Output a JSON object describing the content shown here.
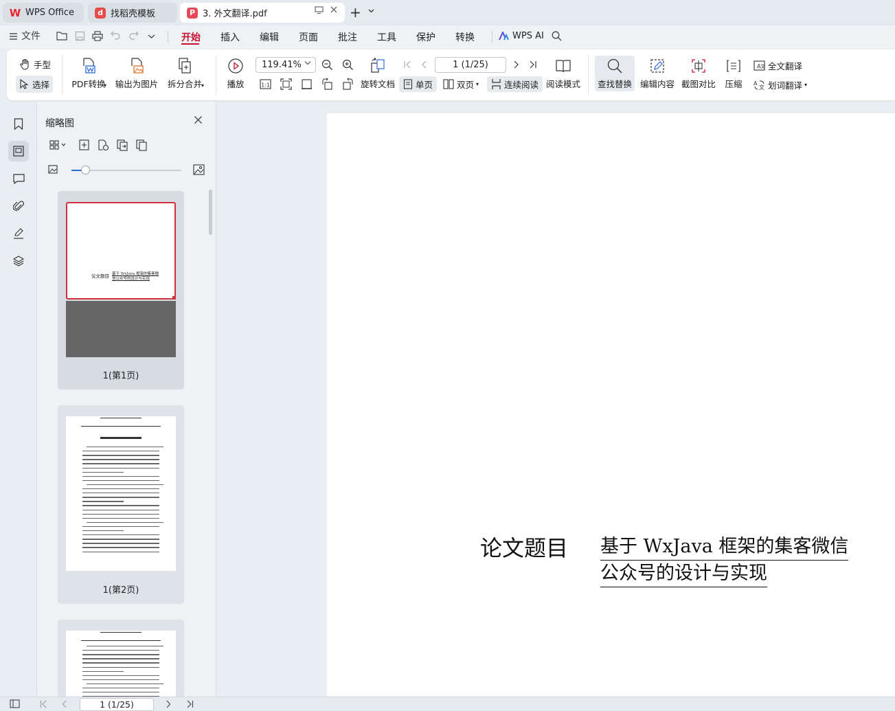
{
  "tabs": [
    {
      "label": "WPS Office",
      "logo_color": "#e8242d"
    },
    {
      "label": "找稻壳模板",
      "logo_color": "#e84a4a"
    },
    {
      "label": "3. 外文翻译.pdf",
      "logo_color": "#e64a5a"
    }
  ],
  "menu": {
    "file": "文件",
    "items": [
      "开始",
      "插入",
      "编辑",
      "页面",
      "批注",
      "工具",
      "保护",
      "转换"
    ],
    "active_index": 0,
    "wps_ai": "WPS AI"
  },
  "ribbon": {
    "hand": "手型",
    "select": "选择",
    "pdf_convert": "PDF转换",
    "export_image": "输出为图片",
    "split_merge": "拆分合并",
    "play": "播放",
    "zoom_value": "119.41%",
    "page_value": "1 (1/25)",
    "rotate_doc": "旋转文档",
    "single_page": "单页",
    "double_page": "双页",
    "continuous": "连续阅读",
    "read_mode": "阅读模式",
    "find_replace": "查找替换",
    "edit_content": "编辑内容",
    "screenshot_compare": "截图对比",
    "compress": "压缩",
    "full_translate": "全文翻译",
    "word_translate": "划词翻译"
  },
  "thumbnail_panel": {
    "title": "缩略图",
    "pages": [
      {
        "caption": "1(第1页)",
        "label_left": "论文题目",
        "label_right": "基于 WxJava 框架的集客微信公众号的设计与实现"
      },
      {
        "caption": "1(第2页)"
      },
      {
        "caption": ""
      }
    ]
  },
  "document": {
    "title_label": "论文题目",
    "title_value_line1": "基于 WxJava 框架的集客微信",
    "title_value_line2": "公众号的设计与实现"
  },
  "statusbar": {
    "page_value": "1 (1/25)"
  },
  "colors": {
    "accent": "#c8102e",
    "selection_border": "#d0303a",
    "slider": "#2a6ad6"
  }
}
